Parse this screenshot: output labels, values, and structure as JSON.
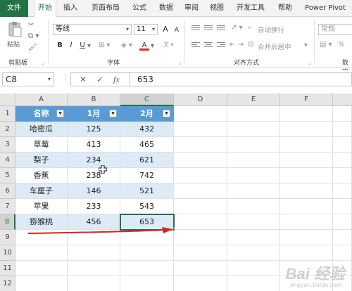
{
  "ribbon_tabs": [
    "文件",
    "开始",
    "插入",
    "页面布局",
    "公式",
    "数据",
    "审阅",
    "视图",
    "开发工具",
    "帮助",
    "Power Pivot"
  ],
  "ribbon": {
    "clipboard": {
      "paste_label": "粘贴",
      "group_label": "剪贴板"
    },
    "font": {
      "font_name": "等线",
      "font_size": "11",
      "bold": "B",
      "italic": "I",
      "underline": "U",
      "grow": "A",
      "shrink": "A",
      "font_color": "A",
      "group_label": "字体"
    },
    "alignment": {
      "wrap_text": "自动换行",
      "merge_center": "合并后居中",
      "group_label": "对齐方式"
    },
    "number": {
      "format": "常规",
      "percent": "%",
      "group_label": "数字"
    }
  },
  "formula_bar": {
    "name_box": "C8",
    "cancel_icon": "✕",
    "enter_icon": "✓",
    "fx_label": "fx",
    "value": "653"
  },
  "sheet": {
    "columns": [
      "A",
      "B",
      "C",
      "D",
      "E",
      "F"
    ],
    "rows": [
      "1",
      "2",
      "3",
      "4",
      "5",
      "6",
      "7",
      "8",
      "9",
      "10",
      "11",
      "12"
    ],
    "selected_cell": "C8",
    "table_header": [
      "名称",
      "1月",
      "2月"
    ],
    "table_rows": [
      [
        "哈密瓜",
        "125",
        "432"
      ],
      [
        "草莓",
        "413",
        "465"
      ],
      [
        "梨子",
        "234",
        "621"
      ],
      [
        "香蕉",
        "238",
        "742"
      ],
      [
        "车厘子",
        "146",
        "521"
      ],
      [
        "苹果",
        "233",
        "543"
      ],
      [
        "猕猴桃",
        "456",
        "653"
      ]
    ]
  },
  "colors": {
    "accent": "#217346",
    "table_header": "#5b9bd5",
    "band": "#ddebf7",
    "arrow": "#e02020"
  },
  "watermark": {
    "main": "Bai 经验",
    "sub": "jingyan.baidu.com"
  }
}
